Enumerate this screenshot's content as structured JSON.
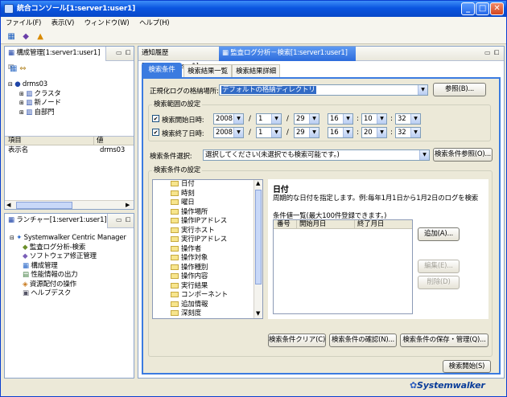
{
  "window": {
    "title": "統合コンソール[1:server1:user1]"
  },
  "menu": [
    "ファイル(F)",
    "表示(V)",
    "ウィンドウ(W)",
    "ヘルプ(H)"
  ],
  "structure_panel": {
    "tab": "構成管理[1:server1:user1]",
    "tree": {
      "root": "drms03",
      "children": [
        "クラスタ",
        "新ノード",
        "自部門"
      ]
    },
    "props": {
      "headers": [
        "項目",
        "値"
      ],
      "rows": [
        [
          "表示名",
          "drms03"
        ]
      ]
    }
  },
  "launcher_panel": {
    "tab": "ランチャー[1:server1:user1]",
    "root": "Systemwalker Centric Manager",
    "items": [
      "監査ログ分析-検索",
      "ソフトウェア修正管理",
      "構成管理",
      "性能情報の出力",
      "資源配付の操作",
      "ヘルプデスク"
    ]
  },
  "editor_tabs": [
    "通知履歴[1:server1:user1]",
    "監査ログ分析－検索[1:server1:user1]"
  ],
  "inner_tabs": [
    "検索条件",
    "検索結果一覧",
    "検索結果詳細"
  ],
  "form": {
    "location_label": "正規化ログの格納場所:",
    "location_value": "デフォルトの格納ディレクトリ",
    "browse_button": "参照(B)...",
    "range_group": "検索範囲の設定",
    "start_label": "検索開始日時:",
    "end_label": "検索終了日時:",
    "start": {
      "year": "2008",
      "month": "1",
      "day": "29",
      "hour": "16",
      "min": "10",
      "sec": "32"
    },
    "end": {
      "year": "2008",
      "month": "1",
      "day": "29",
      "hour": "16",
      "min": "20",
      "sec": "32"
    },
    "slash": "/",
    "colon": ":",
    "cond_select_label": "検索条件選択:",
    "cond_select_value": "選択してください(未選択でも検索可能です。)",
    "cond_ref_button": "検索条件参照(O)...",
    "cond_group": "検索条件の設定",
    "conditions": [
      "日付",
      "時刻",
      "曜日",
      "操作場所",
      "操作IPアドレス",
      "実行ホスト",
      "実行IPアドレス",
      "操作者",
      "操作対象",
      "操作種別",
      "操作内容",
      "実行結果",
      "コンポーネント",
      "追加情報",
      "深刻度"
    ],
    "detail_title": "日付",
    "detail_desc": "周期的な日付を指定します。例:毎年1月1日から1月2日のログを検索",
    "list_caption": "条件値一覧(最大100件登録できます。)",
    "list_headers": [
      "番号",
      "開始月日",
      "終了月日"
    ],
    "add_button": "追加(A)...",
    "edit_button": "編集(E)...",
    "delete_button": "削除(D)",
    "clear_button": "検索条件クリア(C)",
    "confirm_button": "検索条件の確認(N)...",
    "save_button": "検索条件の保存・管理(Q)...",
    "search_button": "検索開始(S)"
  },
  "brand": "Systemwalker",
  "colors": {
    "title_blue": "#0a55e0",
    "accent": "#1f45a8",
    "tab_border": "#3b7be0"
  }
}
